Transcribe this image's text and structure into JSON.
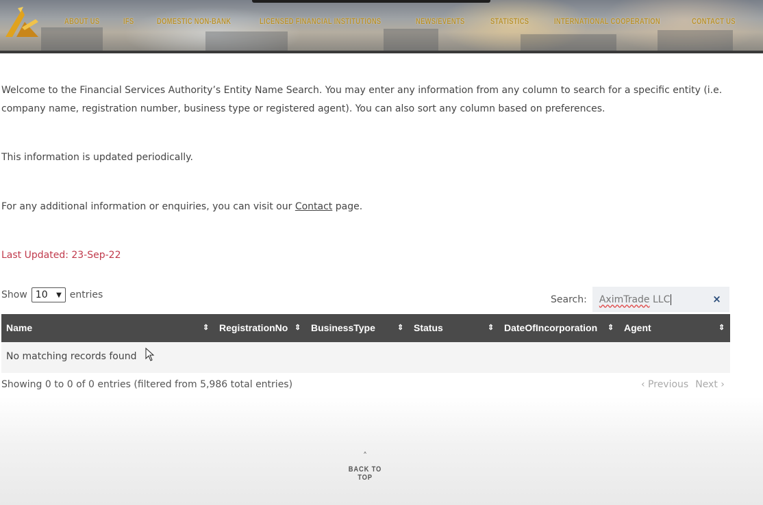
{
  "nav": {
    "items": [
      {
        "label": "ABOUT US"
      },
      {
        "label": "IFS"
      },
      {
        "label": "DOMESTIC NON-BANK"
      },
      {
        "label": "LICENSED FINANCIAL INSTITUTIONS"
      },
      {
        "label": "NEWS/EVENTS"
      },
      {
        "label": "STATISTICS"
      },
      {
        "label": "INTERNATIONAL COOPERATION"
      },
      {
        "label": "CONTACT US"
      }
    ],
    "logo_icon": "fsa-logo-icon"
  },
  "intro": {
    "line1": "Welcome to the Financial Services Authority’s Entity Name Search. You may enter any information from any column to search for a specific entity (i.e.",
    "line2": "company name, registration number, business type or registered agent). You can also sort any column based on preferences.",
    "updated_note": "This information is updated periodically.",
    "enquiries_prefix": "For any additional information or enquiries, you can visit our ",
    "contact_link": "Contact",
    "enquiries_suffix": " page.",
    "last_updated": "Last Updated:  23-Sep-22"
  },
  "table_controls": {
    "show_label": "Show",
    "entries_value": "10",
    "entries_label": "entries",
    "search_label": "Search:",
    "search_value_word1": "AximTrade",
    "search_value_word2": " LLC",
    "clear_symbol": "×"
  },
  "table": {
    "columns": [
      {
        "label": "Name"
      },
      {
        "label": "RegistrationNo"
      },
      {
        "label": "BusinessType"
      },
      {
        "label": "Status"
      },
      {
        "label": "DateOfIncorporation"
      },
      {
        "label": "Agent"
      }
    ],
    "sort_icon": "⇕",
    "empty_message": "No matching records found"
  },
  "table_info": "Showing 0 to 0 of 0 entries (filtered from 5,986 total entries)",
  "pagination": {
    "previous": "‹ Previous",
    "next": "Next ›"
  },
  "footer": {
    "back_to_top": "BACK TO TOP",
    "chevron": "˄"
  },
  "colors": {
    "nav_gold": "#b8912e",
    "table_header": "#4a4a4a",
    "last_updated_red": "#c0394b"
  }
}
